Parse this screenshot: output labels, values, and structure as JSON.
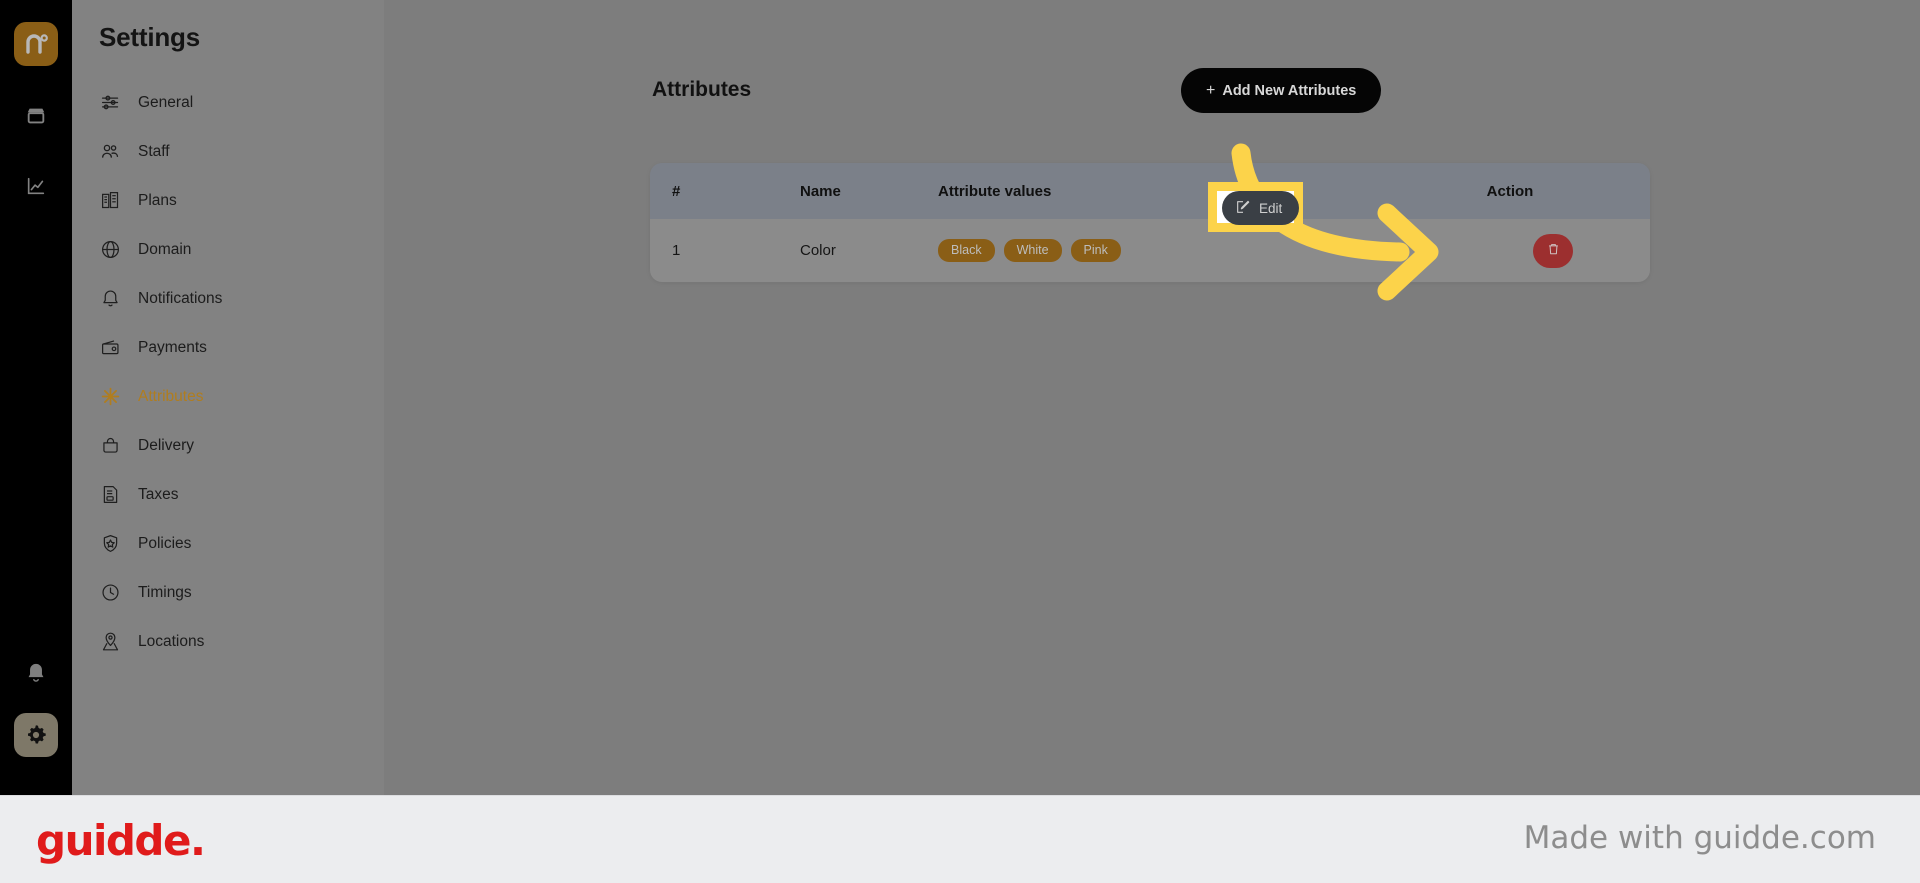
{
  "rail": {
    "logo": {
      "name": "brand-logo",
      "text": "n°"
    },
    "icons": [
      {
        "name": "store-icon",
        "label": "Store"
      },
      {
        "name": "analytics-icon",
        "label": "Analytics"
      }
    ],
    "bell": {
      "name": "bell-icon",
      "label": "Notifications"
    },
    "gear": {
      "name": "gear-icon",
      "label": "Settings"
    }
  },
  "sidebar": {
    "title": "Settings",
    "items": [
      {
        "label": "General",
        "icon": "sliders-icon",
        "active": false
      },
      {
        "label": "Staff",
        "icon": "users-icon",
        "active": false
      },
      {
        "label": "Plans",
        "icon": "buildings-icon",
        "active": false
      },
      {
        "label": "Domain",
        "icon": "globe-icon",
        "active": false
      },
      {
        "label": "Notifications",
        "icon": "bell-icon",
        "active": false
      },
      {
        "label": "Payments",
        "icon": "wallet-icon",
        "active": false
      },
      {
        "label": "Attributes",
        "icon": "asterisk-icon",
        "active": true
      },
      {
        "label": "Delivery",
        "icon": "bag-icon",
        "active": false
      },
      {
        "label": "Taxes",
        "icon": "tax-document-icon",
        "active": false
      },
      {
        "label": "Policies",
        "icon": "shield-icon",
        "active": false
      },
      {
        "label": "Timings",
        "icon": "clock-icon",
        "active": false
      },
      {
        "label": "Locations",
        "icon": "map-pin-icon",
        "active": false
      }
    ]
  },
  "main": {
    "title": "Attributes",
    "add_button": {
      "plus": "+",
      "label": "Add New Attributes"
    },
    "table": {
      "columns": [
        "#",
        "Name",
        "Attribute values",
        "Action"
      ],
      "rows": [
        {
          "num": "1",
          "name": "Color",
          "values": [
            "Black",
            "White",
            "Pink"
          ],
          "edit_label": "Edit",
          "delete_label": "Delete"
        }
      ]
    }
  },
  "annotation": {
    "highlight_target": "Edit",
    "arrow": "curved-arrow-pointing-right"
  },
  "footer": {
    "logo": "guidde.",
    "made_with": "Made with guidde.com"
  },
  "colors": {
    "brand_amber": "#8a5e16",
    "accent_active": "#b07d1f",
    "highlight_yellow": "#fcd34a",
    "danger_red": "#9c2f2f",
    "edit_dark": "#3a3f45",
    "guidde_red": "#e01b1b"
  }
}
